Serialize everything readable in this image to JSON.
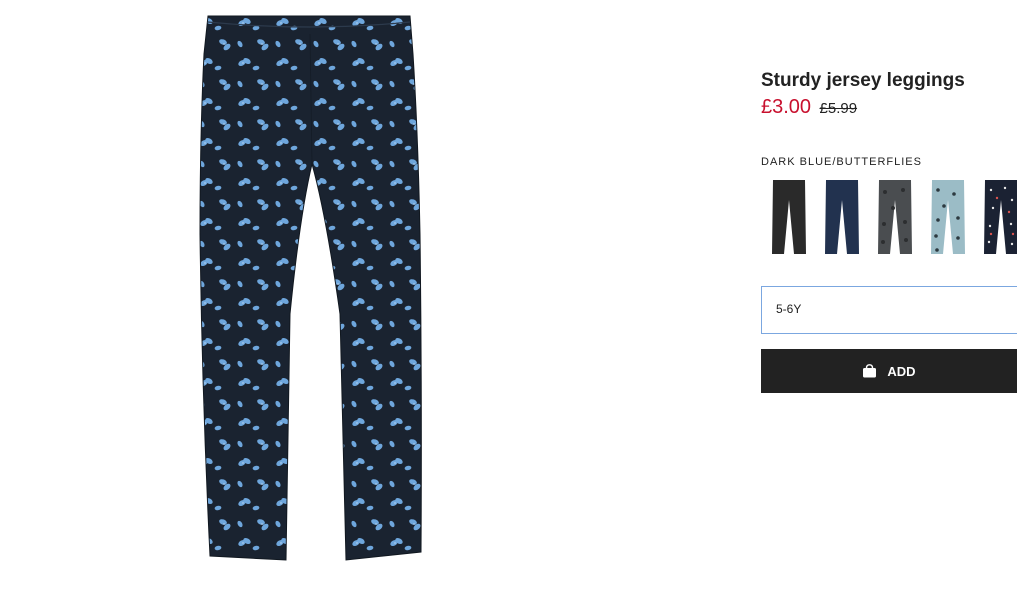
{
  "product": {
    "title": "Sturdy jersey leggings",
    "price": "£3.00",
    "original_price": "£5.99",
    "color_name": "DARK BLUE/BUTTERFLIES",
    "selected_size": "5-6Y",
    "add_label": "ADD"
  },
  "colors": {
    "sale": "#c8102e",
    "button_bg": "#222222",
    "select_border": "#7ba7e0",
    "main_fabric": "#1a2330",
    "butterfly": "#6ea6dc"
  },
  "swatches": [
    {
      "name": "Black",
      "color": "#2a2a2a",
      "pattern": "plain"
    },
    {
      "name": "Dark blue",
      "color": "#22324f",
      "pattern": "plain"
    },
    {
      "name": "Dark grey/stars",
      "color": "#4a4d50",
      "pattern": "stars"
    },
    {
      "name": "Light turquoise/stars",
      "color": "#9bbcc6",
      "pattern": "stars"
    },
    {
      "name": "Dark blue/spots",
      "color": "#1b2233",
      "pattern": "spots"
    }
  ]
}
